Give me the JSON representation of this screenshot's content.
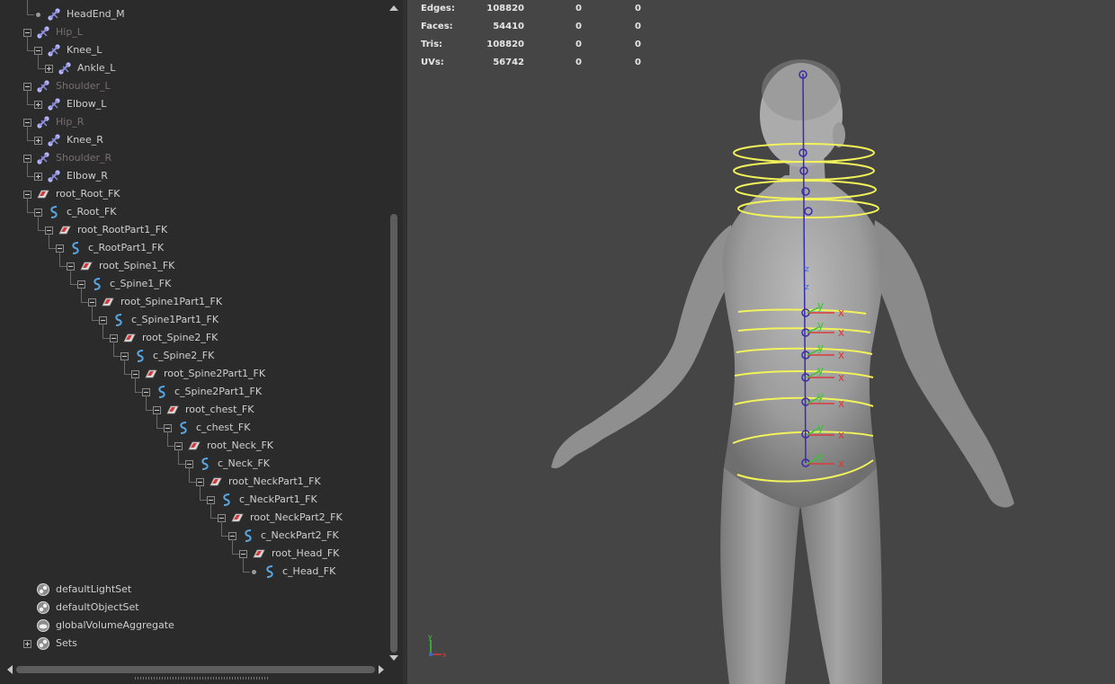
{
  "outliner": {
    "items": [
      {
        "label": "HeadEnd_M",
        "indent": 1,
        "toggle": "leaf",
        "icon": "joint",
        "dim": false
      },
      {
        "label": "Hip_L",
        "indent": 0,
        "toggle": "minus",
        "icon": "joint",
        "dim": true
      },
      {
        "label": "Knee_L",
        "indent": 1,
        "toggle": "minus",
        "icon": "joint",
        "dim": false
      },
      {
        "label": "Ankle_L",
        "indent": 2,
        "toggle": "plus",
        "icon": "joint",
        "dim": false
      },
      {
        "label": "Shoulder_L",
        "indent": 0,
        "toggle": "minus",
        "icon": "joint",
        "dim": true
      },
      {
        "label": "Elbow_L",
        "indent": 1,
        "toggle": "plus",
        "icon": "joint",
        "dim": false
      },
      {
        "label": "Hip_R",
        "indent": 0,
        "toggle": "minus",
        "icon": "joint",
        "dim": true
      },
      {
        "label": "Knee_R",
        "indent": 1,
        "toggle": "plus",
        "icon": "joint",
        "dim": false
      },
      {
        "label": "Shoulder_R",
        "indent": 0,
        "toggle": "minus",
        "icon": "joint",
        "dim": true
      },
      {
        "label": "Elbow_R",
        "indent": 1,
        "toggle": "plus",
        "icon": "joint",
        "dim": false
      },
      {
        "label": "root_Root_FK",
        "indent": 0,
        "toggle": "minus",
        "icon": "group",
        "dim": false
      },
      {
        "label": "c_Root_FK",
        "indent": 1,
        "toggle": "minus",
        "icon": "curve",
        "dim": false
      },
      {
        "label": "root_RootPart1_FK",
        "indent": 2,
        "toggle": "minus",
        "icon": "group",
        "dim": false
      },
      {
        "label": "c_RootPart1_FK",
        "indent": 3,
        "toggle": "minus",
        "icon": "curve",
        "dim": false
      },
      {
        "label": "root_Spine1_FK",
        "indent": 4,
        "toggle": "minus",
        "icon": "group",
        "dim": false
      },
      {
        "label": "c_Spine1_FK",
        "indent": 5,
        "toggle": "minus",
        "icon": "curve",
        "dim": false
      },
      {
        "label": "root_Spine1Part1_FK",
        "indent": 6,
        "toggle": "minus",
        "icon": "group",
        "dim": false
      },
      {
        "label": "c_Spine1Part1_FK",
        "indent": 7,
        "toggle": "minus",
        "icon": "curve",
        "dim": false
      },
      {
        "label": "root_Spine2_FK",
        "indent": 8,
        "toggle": "minus",
        "icon": "group",
        "dim": false
      },
      {
        "label": "c_Spine2_FK",
        "indent": 9,
        "toggle": "minus",
        "icon": "curve",
        "dim": false
      },
      {
        "label": "root_Spine2Part1_FK",
        "indent": 10,
        "toggle": "minus",
        "icon": "group",
        "dim": false
      },
      {
        "label": "c_Spine2Part1_FK",
        "indent": 11,
        "toggle": "minus",
        "icon": "curve",
        "dim": false
      },
      {
        "label": "root_chest_FK",
        "indent": 12,
        "toggle": "minus",
        "icon": "group",
        "dim": false
      },
      {
        "label": "c_chest_FK",
        "indent": 13,
        "toggle": "minus",
        "icon": "curve",
        "dim": false
      },
      {
        "label": "root_Neck_FK",
        "indent": 14,
        "toggle": "minus",
        "icon": "group",
        "dim": false
      },
      {
        "label": "c_Neck_FK",
        "indent": 15,
        "toggle": "minus",
        "icon": "curve",
        "dim": false
      },
      {
        "label": "root_NeckPart1_FK",
        "indent": 16,
        "toggle": "minus",
        "icon": "group",
        "dim": false
      },
      {
        "label": "c_NeckPart1_FK",
        "indent": 17,
        "toggle": "minus",
        "icon": "curve",
        "dim": false
      },
      {
        "label": "root_NeckPart2_FK",
        "indent": 18,
        "toggle": "minus",
        "icon": "group",
        "dim": false
      },
      {
        "label": "c_NeckPart2_FK",
        "indent": 19,
        "toggle": "minus",
        "icon": "curve",
        "dim": false
      },
      {
        "label": "root_Head_FK",
        "indent": 20,
        "toggle": "minus",
        "icon": "group",
        "dim": false
      },
      {
        "label": "c_Head_FK",
        "indent": 21,
        "toggle": "leaf",
        "icon": "curve",
        "dim": false
      },
      {
        "label": "defaultLightSet",
        "indent": 0,
        "toggle": "none",
        "icon": "set",
        "dim": false
      },
      {
        "label": "defaultObjectSet",
        "indent": 0,
        "toggle": "none",
        "icon": "set",
        "dim": false
      },
      {
        "label": "globalVolumeAggregate",
        "indent": 0,
        "toggle": "none",
        "icon": "volume",
        "dim": false
      },
      {
        "label": "Sets",
        "indent": 0,
        "toggle": "plus",
        "icon": "set",
        "dim": false
      }
    ]
  },
  "heads_up": {
    "rows": [
      {
        "label": "Edges:",
        "v1": "108820",
        "v2": "0",
        "v3": "0"
      },
      {
        "label": "Faces:",
        "v1": "54410",
        "v2": "0",
        "v3": "0"
      },
      {
        "label": "Tris:",
        "v1": "108820",
        "v2": "0",
        "v3": "0"
      },
      {
        "label": "UVs:",
        "v1": "56742",
        "v2": "0",
        "v3": "0"
      }
    ]
  },
  "viewport": {
    "axis_labels": {
      "x": "x",
      "y": "y",
      "z": "z"
    },
    "colors": {
      "background": "#454545",
      "controls": "#f2f25a",
      "joints": "#3a2ca8",
      "x_axis": "#d93a3a",
      "y_axis": "#38c438"
    }
  }
}
